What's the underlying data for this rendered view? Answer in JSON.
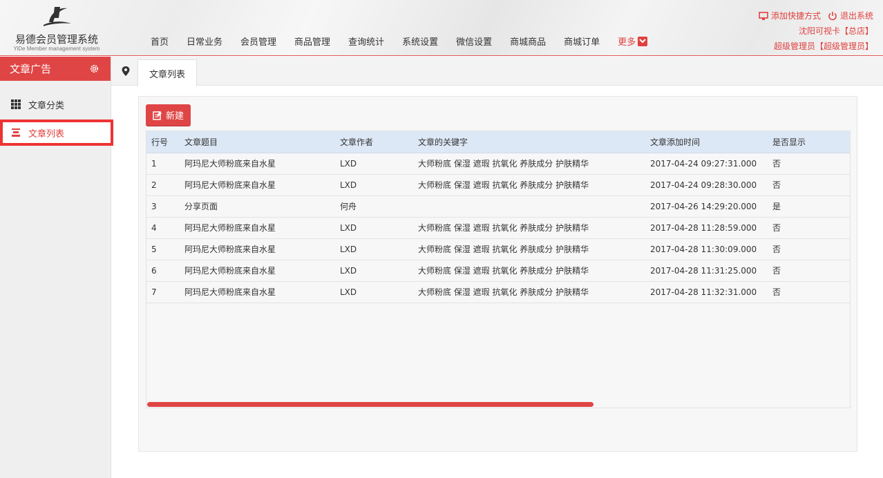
{
  "app": {
    "name_cn": "易德会员管理系统",
    "name_en": "YiDe Member management system"
  },
  "nav": {
    "items": [
      "首页",
      "日常业务",
      "会员管理",
      "商品管理",
      "查询统计",
      "系统设置",
      "微信设置",
      "商城商品",
      "商城订单"
    ],
    "more": "更多"
  },
  "topright": {
    "shortcut": "添加快捷方式",
    "logout": "退出系统",
    "store": "沈阳可视卡【总店】",
    "user": "超级管理员【超级管理员】"
  },
  "sidebar": {
    "title": "文章广告",
    "items": [
      {
        "label": "文章分类",
        "icon": "grid-icon"
      },
      {
        "label": "文章列表",
        "icon": "list-icon"
      }
    ]
  },
  "tabs": {
    "active": "文章列表"
  },
  "toolbar": {
    "new_label": "新建"
  },
  "table": {
    "columns": [
      "行号",
      "文章题目",
      "文章作者",
      "文章的关键字",
      "文章添加时间",
      "是否显示"
    ],
    "rows": [
      [
        "1",
        "阿玛尼大师粉底来自水星",
        "LXD",
        "大师粉底 保湿 遮瑕 抗氧化 养肤成分 护肤精华",
        "2017-04-24 09:27:31.000",
        "否"
      ],
      [
        "2",
        "阿玛尼大师粉底来自水星",
        "LXD",
        "大师粉底 保湿 遮瑕 抗氧化 养肤成分 护肤精华",
        "2017-04-24 09:28:30.000",
        "否"
      ],
      [
        "3",
        "分享页面",
        "何舟",
        "",
        "2017-04-26 14:29:20.000",
        "是"
      ],
      [
        "4",
        "阿玛尼大师粉底来自水星",
        "LXD",
        "大师粉底 保湿 遮瑕 抗氧化 养肤成分 护肤精华",
        "2017-04-28 11:28:59.000",
        "否"
      ],
      [
        "5",
        "阿玛尼大师粉底来自水星",
        "LXD",
        "大师粉底 保湿 遮瑕 抗氧化 养肤成分 护肤精华",
        "2017-04-28 11:30:09.000",
        "否"
      ],
      [
        "6",
        "阿玛尼大师粉底来自水星",
        "LXD",
        "大师粉底 保湿 遮瑕 抗氧化 养肤成分 护肤精华",
        "2017-04-28 11:31:25.000",
        "否"
      ],
      [
        "7",
        "阿玛尼大师粉底来自水星",
        "LXD",
        "大师粉底 保湿 遮瑕 抗氧化 养肤成分 护肤精华",
        "2017-04-28 11:32:31.000",
        "否"
      ]
    ]
  },
  "colors": {
    "accent": "#e04545",
    "header_row": "#dde8f6"
  }
}
